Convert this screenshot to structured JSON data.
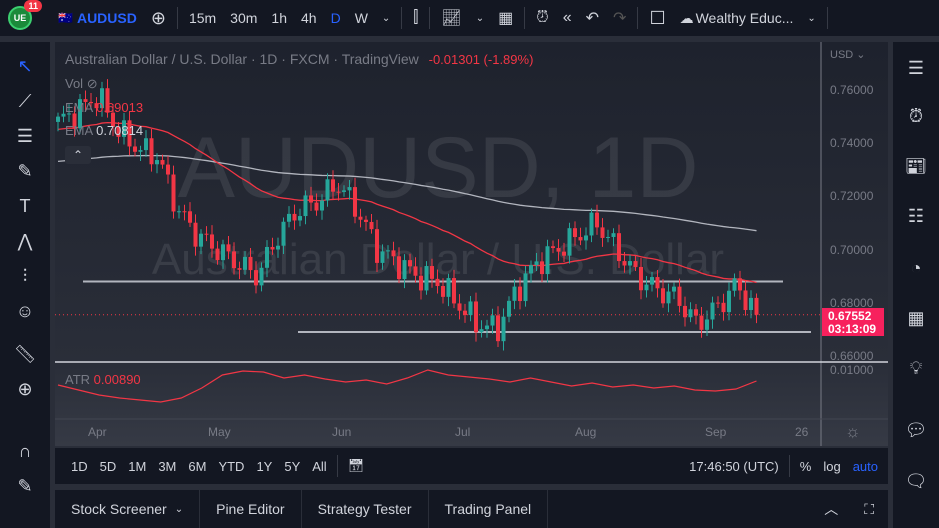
{
  "topbar": {
    "badge": "11",
    "symbol": "AUDUSD",
    "intervals": [
      "15m",
      "30m",
      "1h",
      "4h",
      "D",
      "W"
    ],
    "active_interval": "D",
    "layout_name": "Wealthy Educ..."
  },
  "legend": {
    "title": "Australian Dollar / U.S. Dollar · 1D · FXCM · TradingView",
    "change": "-0.01301 (-1.89%)",
    "vol": "Vol",
    "ema1_label": "EMA",
    "ema1_value": "0.69013",
    "ema2_label": "EMA",
    "ema2_value": "0.70814",
    "atr_label": "ATR",
    "atr_value": "0.00890"
  },
  "watermark": {
    "symbol": "AUDUSD, 1D",
    "name": "Australian Dollar / U.S. Dollar"
  },
  "price_axis": {
    "currency": "USD",
    "ticks": [
      "0.76000",
      "0.74000",
      "0.72000",
      "0.70000",
      "0.68000",
      "0.66000"
    ],
    "last_price": "0.67552",
    "countdown": "03:13:09",
    "atr_tick": "0.01000"
  },
  "time_axis": [
    "Apr",
    "May",
    "Jun",
    "Jul",
    "Aug",
    "Sep",
    "26"
  ],
  "range_bar": {
    "ranges": [
      "1D",
      "5D",
      "1M",
      "3M",
      "6M",
      "YTD",
      "1Y",
      "5Y",
      "All"
    ],
    "time": "17:46:50 (UTC)",
    "percent": "%",
    "log": "log",
    "auto": "auto"
  },
  "bottom_tabs": [
    "Stock Screener",
    "Pine Editor",
    "Strategy Tester",
    "Trading Panel"
  ],
  "colors": {
    "up": "#26a69a",
    "down": "#f23645",
    "ema_fast": "#f23645",
    "ema_slow": "#b2b5be",
    "accent": "#2962ff",
    "price_label": "#f7215d"
  },
  "chart_data": {
    "type": "candlestick",
    "symbol": "AUDUSD",
    "interval": "1D",
    "ylim": [
      0.66,
      0.765
    ],
    "weekly_closes": [
      0.748,
      0.752,
      0.758,
      0.745,
      0.738,
      0.735,
      0.715,
      0.705,
      0.7,
      0.695,
      0.69,
      0.705,
      0.715,
      0.718,
      0.725,
      0.715,
      0.7,
      0.695,
      0.69,
      0.688,
      0.68,
      0.672,
      0.67,
      0.685,
      0.695,
      0.7,
      0.705,
      0.71,
      0.7,
      0.69,
      0.685,
      0.682,
      0.672,
      0.678,
      0.687,
      0.6755
    ],
    "ema_fast_start": 0.745,
    "ema_fast_period": 50,
    "ema_slow_start": 0.733,
    "ema_slow_period": 200,
    "horizontal_levels": [
      0.688,
      0.669
    ],
    "atr_series": [
      0.0085,
      0.008,
      0.0075,
      0.0072,
      0.007,
      0.0068,
      0.0072,
      0.0082,
      0.0095,
      0.0099,
      0.0098,
      0.0092,
      0.0095,
      0.0091,
      0.0088,
      0.009,
      0.0086,
      0.0092,
      0.01,
      0.0095,
      0.0093,
      0.0091,
      0.0088,
      0.0092,
      0.0088,
      0.0084,
      0.0087,
      0.0083,
      0.0085,
      0.0082,
      0.0084,
      0.008,
      0.0079,
      0.0081,
      0.0089
    ],
    "atr_ylim": [
      0.006,
      0.0105
    ]
  }
}
